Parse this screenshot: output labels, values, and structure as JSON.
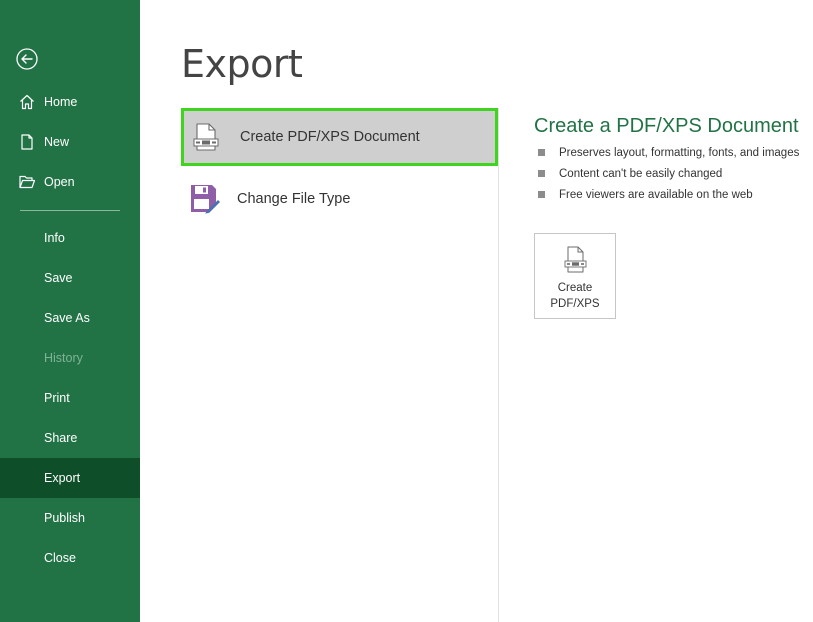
{
  "sidebar": {
    "items": [
      {
        "label": "Home",
        "icon": "home-icon"
      },
      {
        "label": "New",
        "icon": "new-document-icon"
      },
      {
        "label": "Open",
        "icon": "open-folder-icon"
      },
      {
        "label": "Info"
      },
      {
        "label": "Save"
      },
      {
        "label": "Save As"
      },
      {
        "label": "History",
        "disabled": true
      },
      {
        "label": "Print"
      },
      {
        "label": "Share"
      },
      {
        "label": "Export",
        "active": true
      },
      {
        "label": "Publish"
      },
      {
        "label": "Close"
      }
    ]
  },
  "main": {
    "title": "Export",
    "options": [
      {
        "label": "Create PDF/XPS Document",
        "icon": "pdf-document-icon",
        "selected": true
      },
      {
        "label": "Change File Type",
        "icon": "change-file-type-icon",
        "selected": false
      }
    ]
  },
  "details": {
    "title": "Create a PDF/XPS Document",
    "bullets": [
      "Preserves layout, formatting, fonts, and images",
      "Content can't be easily changed",
      "Free viewers are available on the web"
    ],
    "button_line1": "Create",
    "button_line2": "PDF/XPS"
  },
  "colors": {
    "sidebar_bg": "#217346",
    "sidebar_active": "#0e4f2a",
    "accent_green": "#217346",
    "selection_border": "#3fd41e"
  }
}
